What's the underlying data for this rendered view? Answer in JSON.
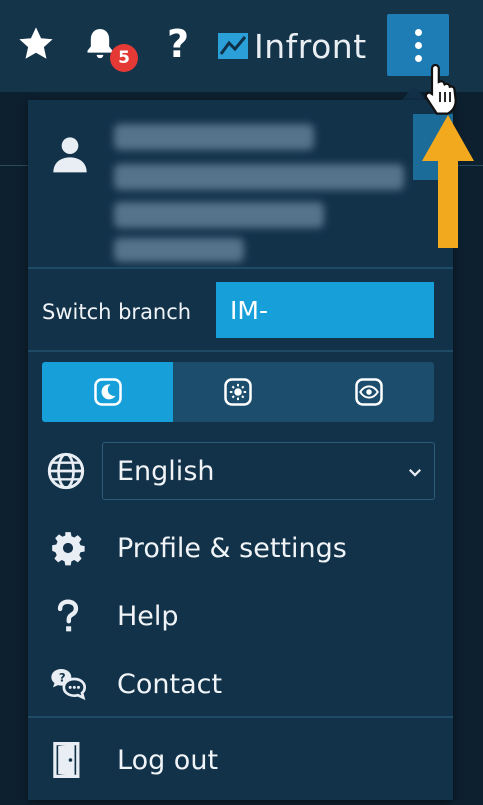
{
  "topbar": {
    "notification_count": "5",
    "help_glyph": "?",
    "brand": "Infront",
    "icons": [
      "star-icon",
      "bell-icon",
      "help-icon",
      "infront-logo-icon",
      "kebab-menu-icon"
    ]
  },
  "menu": {
    "switch_branch_label": "Switch branch",
    "branch_value": "IM-",
    "theme_options": [
      "dark-theme-icon",
      "light-theme-icon",
      "eye-theme-icon"
    ],
    "theme_selected": 0,
    "language": {
      "selected": "English",
      "icon": "globe-icon"
    },
    "items": [
      {
        "label": "Profile & settings",
        "icon": "gear-icon"
      },
      {
        "label": "Help",
        "icon": "question-icon"
      },
      {
        "label": "Contact",
        "icon": "chat-icon"
      },
      {
        "label": "Log out",
        "icon": "door-icon"
      }
    ]
  },
  "colors": {
    "accent": "#169fd8",
    "panel": "#12324a",
    "topbar": "#14344a",
    "badge": "#e53935",
    "arrow": "#f2a91d"
  }
}
